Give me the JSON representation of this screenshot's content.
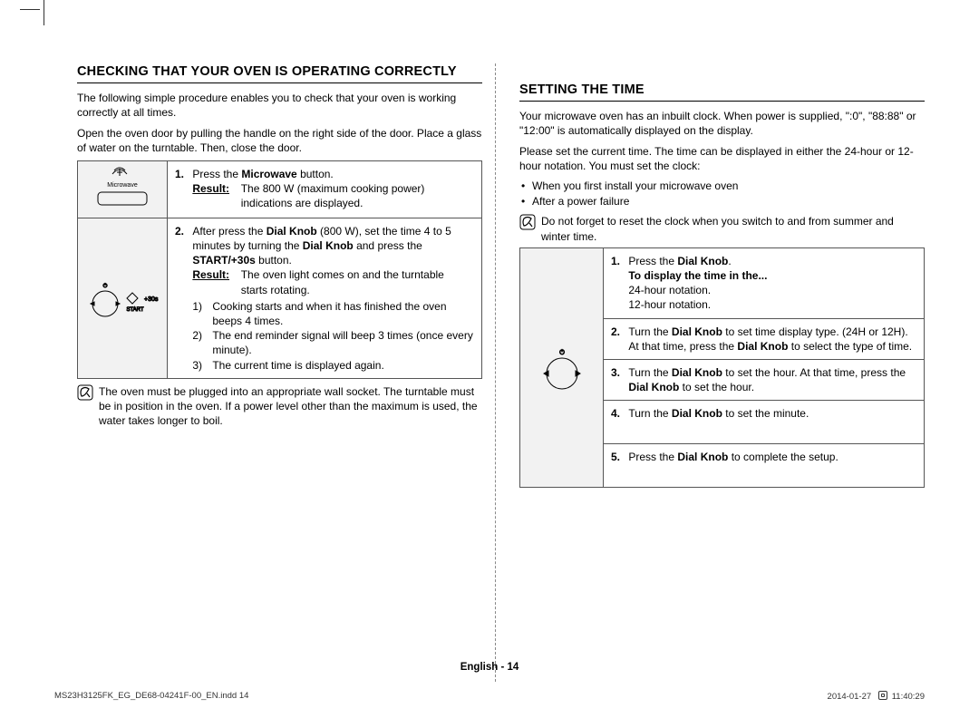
{
  "left": {
    "heading": "CHECKING THAT YOUR OVEN IS OPERATING CORRECTLY",
    "intro1": "The following simple procedure enables you to check that your oven is working correctly at all times.",
    "intro2": "Open the oven door by pulling the handle on the right side of the door. Place a glass of water on the turntable. Then, close the door.",
    "microwave_label": "Microwave",
    "start30_label": "+30s",
    "start_label": "START",
    "step1_pre": "Press the ",
    "step1_bold": "Microwave",
    "step1_post": " button.",
    "step1_result": "The 800 W (maximum cooking power) indications are displayed.",
    "step2_pre": "After press the ",
    "step2_bold1": "Dial Knob",
    "step2_mid1": " (800 W), set the time 4 to 5 minutes by turning the ",
    "step2_bold2": "Dial Knob",
    "step2_mid2": " and press the ",
    "step2_bold3": "START/+30s",
    "step2_post": " button.",
    "step2_result": "The oven light comes on and the turntable starts rotating.",
    "step2_sub1": "Cooking starts and when it has finished the oven beeps 4 times.",
    "step2_sub2": "The end reminder signal will beep 3 times (once every minute).",
    "step2_sub3": "The current time is displayed again.",
    "note": "The oven must be plugged into an appropriate wall socket. The turntable must be in position in the oven. If a power level other than the maximum is used, the water takes longer to boil.",
    "result_label": "Result:"
  },
  "right": {
    "heading": "SETTING THE TIME",
    "intro1": "Your microwave oven has an inbuilt clock. When power is supplied, \":0\", \"88:88\" or \"12:00\" is automatically displayed on the display.",
    "intro2": "Please set the current time. The time can be displayed in either the 24-hour or 12-hour notation. You must set the clock:",
    "bullet1": "When you first install your microwave oven",
    "bullet2": "After a power failure",
    "note": "Do not forget to reset the clock when you switch to and from summer and winter time.",
    "step1_pre": "Press the ",
    "step1_bold": "Dial Knob",
    "step1_post": ".",
    "step1_sub_bold": "To display the time in the...",
    "step1_sub1": "24-hour notation.",
    "step1_sub2": "12-hour notation.",
    "step2_pre": "Turn the ",
    "step2_bold1": "Dial Knob",
    "step2_mid": " to set time display type. (24H or 12H). At that time, press the ",
    "step2_bold2": "Dial Knob",
    "step2_post": " to select the type of time.",
    "step3_pre": "Turn the ",
    "step3_bold1": "Dial Knob",
    "step3_mid": " to set the hour. At that time, press the ",
    "step3_bold2": "Dial Knob",
    "step3_post": " to set the hour.",
    "step4_pre": "Turn the ",
    "step4_bold": "Dial Knob",
    "step4_post": " to set the minute.",
    "step5_pre": "Press the ",
    "step5_bold": "Dial Knob",
    "step5_post": " to complete the setup."
  },
  "footer": {
    "lang_page": "English - 14",
    "file": "MS23H3125FK_EG_DE68-04241F-00_EN.indd   14",
    "date": "2014-01-27",
    "time": "11:40:29"
  }
}
